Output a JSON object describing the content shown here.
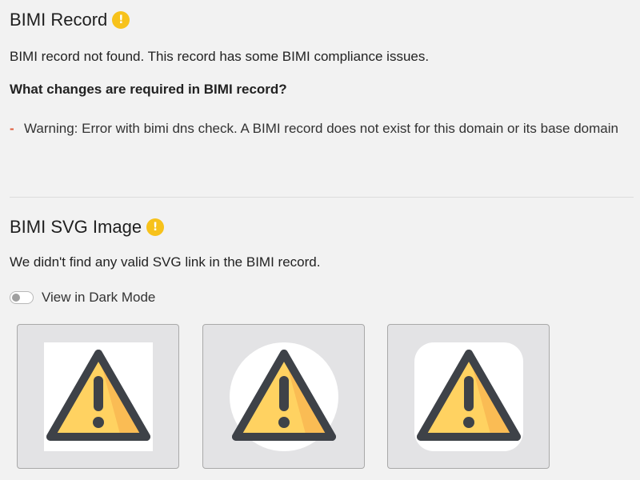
{
  "bimi_record": {
    "title": "BIMI Record",
    "badge": "!",
    "status_text": "BIMI record not found. This record has some BIMI compliance issues.",
    "changes_heading": "What changes are required in BIMI record?",
    "warnings": [
      {
        "bullet": "-",
        "text": "Warning: Error with bimi dns check. A BIMI record does not exist for this domain or its base domain"
      }
    ]
  },
  "bimi_svg": {
    "title": "BIMI SVG Image",
    "badge": "!",
    "status_text": "We didn't find any valid SVG link in the BIMI record.",
    "dark_mode_toggle": {
      "label": "View in Dark Mode",
      "enabled": false
    },
    "previews": [
      {
        "shape": "square",
        "icon": "warning-triangle-icon"
      },
      {
        "shape": "circle",
        "icon": "warning-triangle-icon"
      },
      {
        "shape": "rounded-square",
        "icon": "warning-triangle-icon"
      }
    ]
  },
  "colors": {
    "badge_yellow": "#f7c21b",
    "bullet_red": "#e05a3a",
    "triangle_fill": "#ffd261",
    "triangle_shade": "#f6a94a",
    "triangle_stroke": "#3e4248"
  }
}
